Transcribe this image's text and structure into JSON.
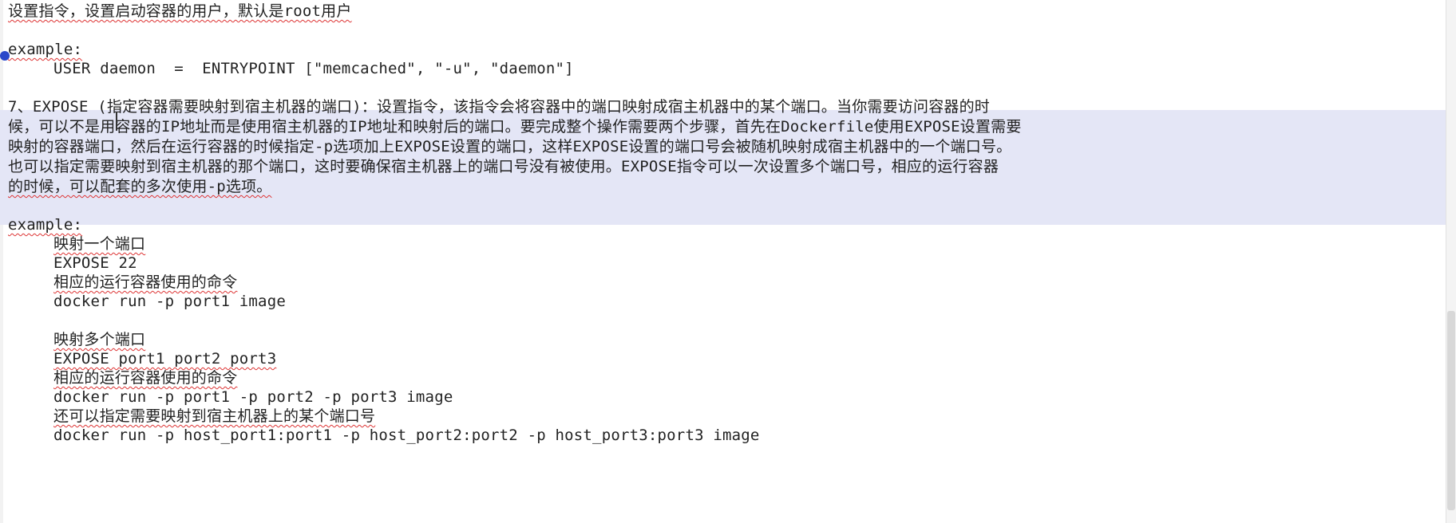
{
  "editor": {
    "lines": [
      "设置指令，设置启动容器的用户，默认是root用户",
      "",
      "example:",
      "USER daemon  =  ENTRYPOINT [\"memcached\", \"-u\", \"daemon\"]",
      "",
      "7、EXPOSE (指定容器需要映射到宿主机器的端口)：设置指令，该指令会将容器中的端口映射成宿主机器中的某个端口。当你需要访问容器的时",
      "候，可以不是用容器的IP地址而是使用宿主机器的IP地址和映射后的端口。要完成整个操作需要两个步骤，首先在Dockerfile使用EXPOSE设置需要",
      "映射的容器端口，然后在运行容器的时候指定-p选项加上EXPOSE设置的端口，这样EXPOSE设置的端口号会被随机映射成宿主机器中的一个端口号。",
      "也可以指定需要映射到宿主机器的那个端口，这时要确保宿主机器上的端口号没有被使用。EXPOSE指令可以一次设置多个端口号，相应的运行容器",
      "的时候，可以配套的多次使用-p选项。",
      "",
      "example:",
      "映射一个端口",
      "EXPOSE 22",
      "相应的运行容器使用的命令",
      "docker run -p port1 image",
      "",
      "映射多个端口",
      "EXPOSE port1 port2 port3",
      "相应的运行容器使用的命令",
      "docker run -p port1 -p port2 -p port3 image",
      "还可以指定需要映射到宿主机器上的某个端口号",
      "docker run -p host_port1:port1 -p host_port2:port2 -p host_port3:port3 image"
    ]
  },
  "colors": {
    "selection": "#e4e6f6",
    "spell_underline": "#d33",
    "marker": "#2a47c9"
  }
}
